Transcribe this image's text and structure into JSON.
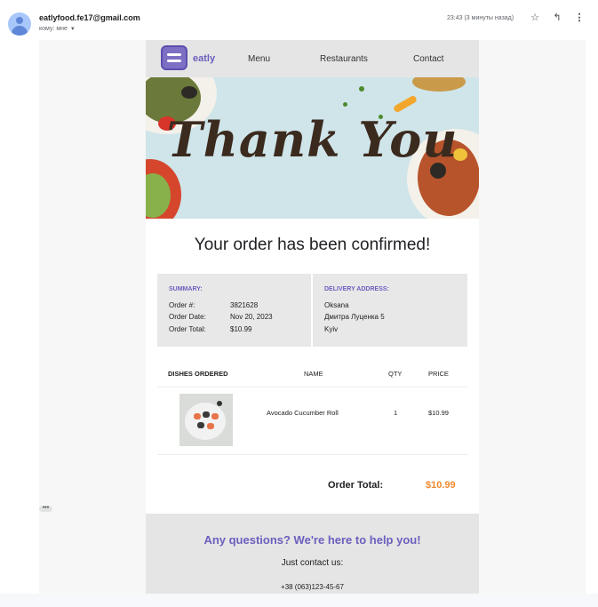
{
  "header": {
    "sender": "eatlyfood.fe17@gmail.com",
    "recipient": "кому: мне",
    "timestamp": "23:43 (3 минуты назад)",
    "icons": [
      "star-icon",
      "reply-icon",
      "more-vert-icon"
    ]
  },
  "email": {
    "nav": {
      "logo": "eatly",
      "links": [
        "Menu",
        "Restaurants",
        "Contact"
      ]
    },
    "hero_text": "Thank You",
    "confirmation": "Your order has been confirmed!",
    "summary": {
      "label": "SUMMARY:",
      "order_number_label": "Order #:",
      "order_number": "3821628",
      "order_date_label": "Order Date:",
      "order_date": "Nov 20, 2023",
      "order_total_label": "Order Total:",
      "order_total": "$10.99"
    },
    "delivery": {
      "label": "DELIVERY ADDRESS:",
      "name": "Oksana",
      "street": "Дмитра Луценка 5",
      "city": "Kyiv"
    },
    "table": {
      "columns": [
        "DISHES ORDERED",
        "NAME",
        "QTY",
        "PRICE"
      ],
      "rows": [
        {
          "name": "Avocado Cucumber Roll",
          "qty": "1",
          "price": "$10.99"
        }
      ]
    },
    "total_label": "Order Total:",
    "total_value": "$10.99",
    "help": {
      "title": "Any questions? We're here to help you!",
      "subtitle": "Just contact us:",
      "phone": "+38 (063)123-45-67"
    }
  },
  "colors": {
    "accent_purple": "#6b5fbe",
    "total_orange": "#f0892e",
    "nav_bg": "#e5e5e5"
  }
}
